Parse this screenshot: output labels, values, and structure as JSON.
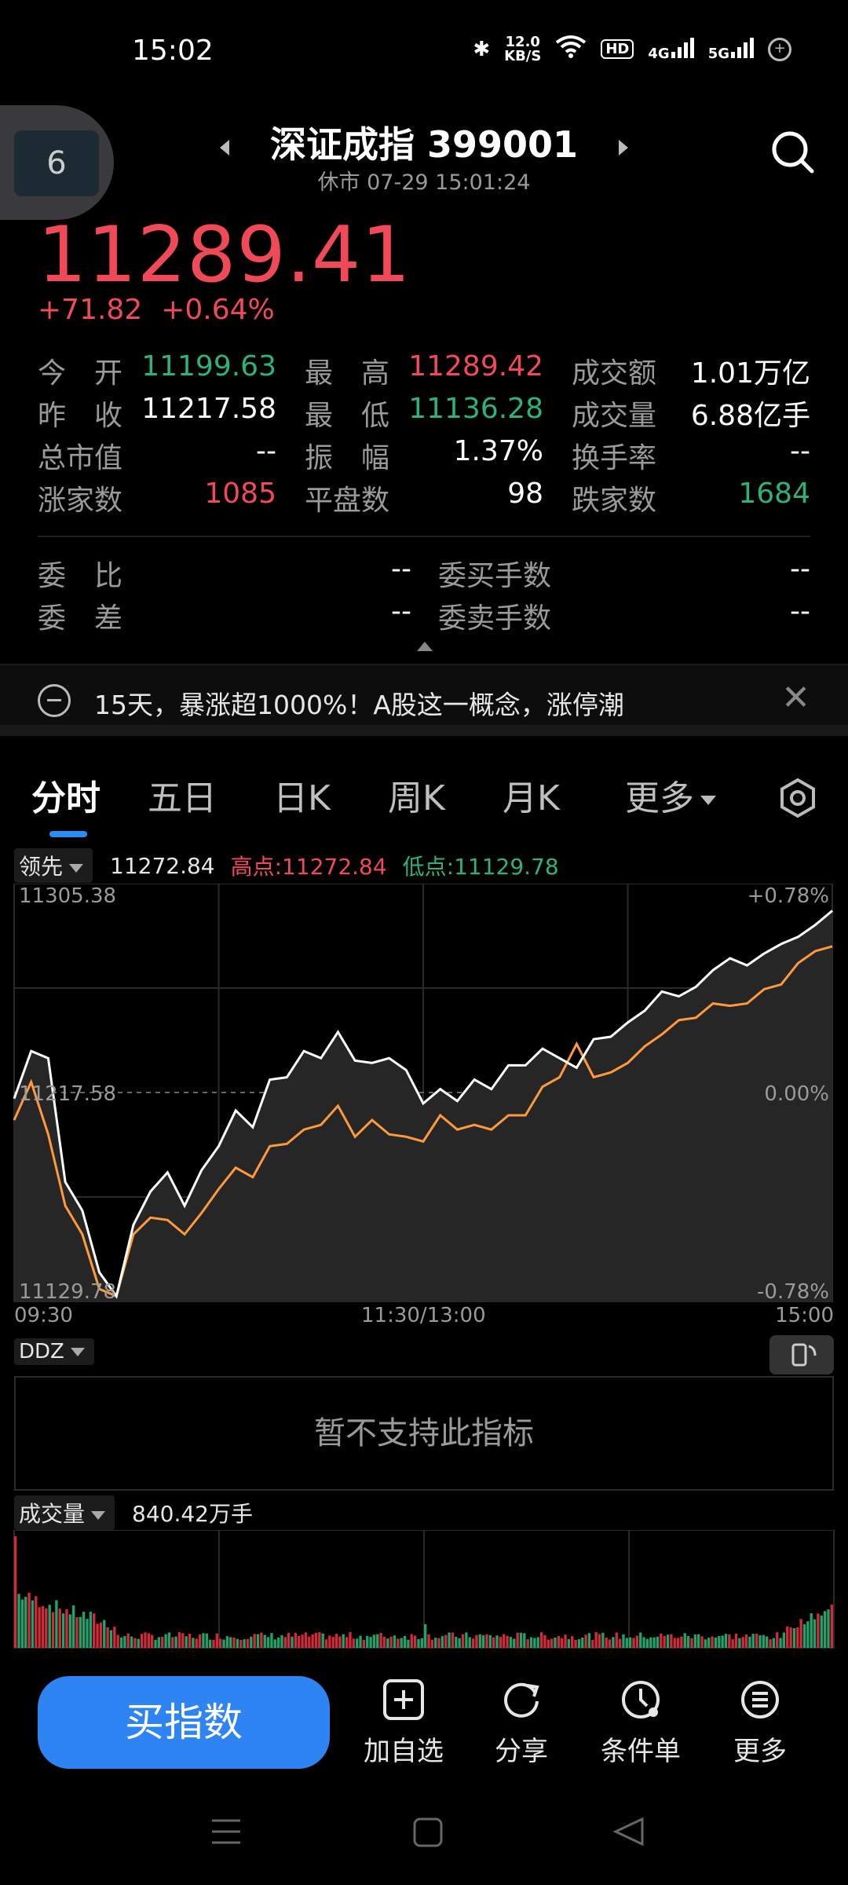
{
  "status": {
    "time": "15:02",
    "speed_top": "12.0",
    "speed_unit": "KB/S",
    "hd": "HD",
    "sig1": "4G",
    "sig2": "5G"
  },
  "header": {
    "title": "深证成指 399001",
    "subtitle": "休市  07-29 15:01:24"
  },
  "quote": {
    "price": "11289.41",
    "change": "+71.82",
    "change_pct": "+0.64%"
  },
  "stats": [
    [
      {
        "label": "今　开",
        "value": "11199.63",
        "color": "green"
      },
      {
        "label": "最　高",
        "value": "11289.42",
        "color": "red"
      },
      {
        "label": "成交额",
        "value": "1.01万亿",
        "color": "white"
      }
    ],
    [
      {
        "label": "昨　收",
        "value": "11217.58",
        "color": "white"
      },
      {
        "label": "最　低",
        "value": "11136.28",
        "color": "green"
      },
      {
        "label": "成交量",
        "value": "6.88亿手",
        "color": "white"
      }
    ],
    [
      {
        "label": "总市值",
        "value": "--",
        "color": "white"
      },
      {
        "label": "振　幅",
        "value": "1.37%",
        "color": "white"
      },
      {
        "label": "换手率",
        "value": "--",
        "color": "white"
      }
    ],
    [
      {
        "label": "涨家数",
        "value": "1085",
        "color": "red"
      },
      {
        "label": "平盘数",
        "value": "98",
        "color": "white"
      },
      {
        "label": "跌家数",
        "value": "1684",
        "color": "green"
      }
    ]
  ],
  "order": [
    [
      {
        "label": "委　比",
        "value": "--"
      },
      {
        "label": "委买手数",
        "value": "--"
      }
    ],
    [
      {
        "label": "委　差",
        "value": "--"
      },
      {
        "label": "委卖手数",
        "value": "--"
      }
    ]
  ],
  "news": {
    "text": "15天，暴涨超1000%！A股这一概念，涨停潮"
  },
  "tabs": [
    "分时",
    "五日",
    "日K",
    "周K",
    "月K",
    "更多"
  ],
  "info": {
    "dropdown": "领先",
    "value": "11272.84",
    "high": "高点:11272.84",
    "low": "低点:11129.78"
  },
  "chart_data": {
    "type": "line",
    "y_left_labels": [
      "11305.38",
      "11217.58",
      "11129.78"
    ],
    "y_right_labels": [
      "+0.78%",
      "0.00%",
      "-0.78%"
    ],
    "x_labels": [
      "09:30",
      "11:30/13:00",
      "15:00"
    ],
    "ylim": [
      11129.78,
      11305.38
    ],
    "x": [
      0,
      5,
      10,
      15,
      20,
      25,
      30,
      35,
      40,
      45,
      50,
      55,
      60,
      65,
      70,
      75,
      80,
      85,
      90,
      95,
      100,
      105,
      110,
      115,
      120,
      125,
      130,
      135,
      140,
      145,
      150,
      155,
      160,
      165,
      170,
      175,
      180,
      185,
      190,
      195,
      200,
      205,
      210,
      215,
      220,
      225,
      230,
      235,
      240
    ],
    "series": [
      {
        "color": "#ffffff",
        "values": [
          11215,
          11235,
          11232,
          11180,
          11168,
          11142,
          11132,
          11162,
          11176,
          11184,
          11170,
          11185,
          11195,
          11210,
          11203,
          11223,
          11224,
          11235,
          11232,
          11243,
          11231,
          11230,
          11232,
          11227,
          11213,
          11219,
          11214,
          11223,
          11219,
          11229,
          11229,
          11236,
          11232,
          11228,
          11240,
          11241,
          11247,
          11252,
          11260,
          11258,
          11262,
          11269,
          11274,
          11271,
          11276,
          11280,
          11283,
          11288,
          11294
        ]
      },
      {
        "color": "#ff9a3c",
        "values": [
          11206,
          11222,
          11200,
          11170,
          11158,
          11135,
          11132,
          11158,
          11165,
          11164,
          11158,
          11167,
          11177,
          11186,
          11182,
          11195,
          11196,
          11202,
          11204,
          11212,
          11199,
          11206,
          11200,
          11199,
          11197,
          11208,
          11202,
          11204,
          11202,
          11208,
          11208,
          11220,
          11224,
          11238,
          11224,
          11226,
          11230,
          11237,
          11242,
          11248,
          11249,
          11255,
          11254,
          11255,
          11261,
          11263,
          11272,
          11277,
          11279
        ]
      }
    ]
  },
  "ddz": {
    "label": "DDZ",
    "message": "暂不支持此指标"
  },
  "volume": {
    "label": "成交量",
    "value": "840.42万手"
  },
  "actions": {
    "buy": "买指数",
    "add": "加自选",
    "share": "分享",
    "condition": "条件单",
    "more": "更多"
  },
  "colors": {
    "up": "#f04a59",
    "down": "#2db37a",
    "accent": "#2d84f2",
    "avg_line": "#ff9a3c"
  }
}
